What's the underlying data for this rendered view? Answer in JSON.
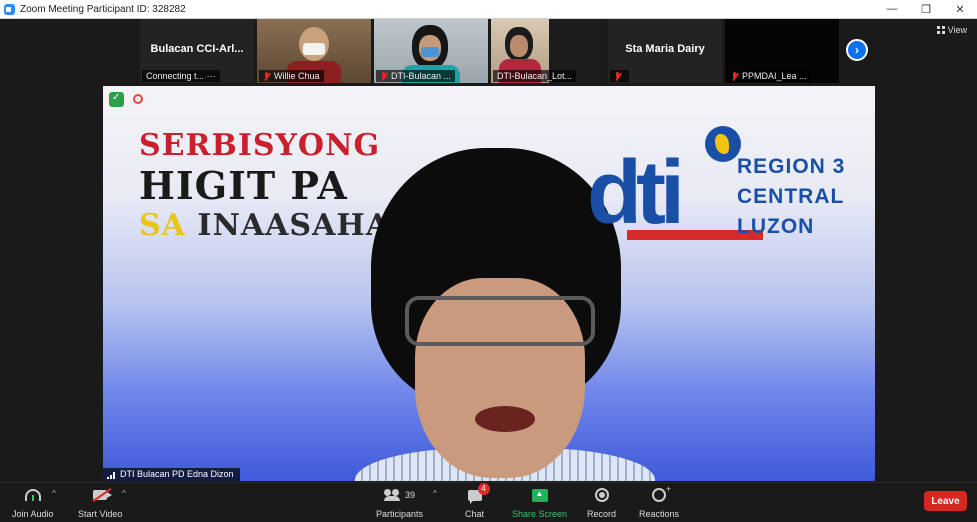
{
  "window": {
    "title": "Zoom Meeting Participant ID: 328282",
    "minimize": "—",
    "restore": "❐",
    "close": "✕"
  },
  "gallery": {
    "tiles": [
      {
        "name": "Bulacan  CCI-Arl...",
        "label": "Connecting t...",
        "extra": "···",
        "video": false
      },
      {
        "name": "",
        "label": "Willie Chua",
        "video": true,
        "muted": true
      },
      {
        "name": "",
        "label": "DTI-Bulacan ...",
        "video": true,
        "muted": true
      },
      {
        "name": "",
        "label": "DTI-Bulacan_Lot...",
        "video": true,
        "muted": false
      },
      {
        "name": "Sta Maria Dairy",
        "label": "",
        "video": false,
        "muted": true
      },
      {
        "name": "",
        "label": "PPMDAI_Lea ...",
        "video": false,
        "muted": true
      }
    ],
    "next_arrow": "›",
    "view_label": "View"
  },
  "speaker": {
    "slogan_line1": "SERBISYONG",
    "slogan_line2": "HIGIT PA",
    "slogan_line3_a": "SA",
    "slogan_line3_b": "INAASAHAN",
    "logo_text": "dti",
    "region_line1": "REGION 3",
    "region_line2": "CENTRAL",
    "region_line3": "LUZON",
    "name_label": "DTI Bulacan PD Edna Dizon"
  },
  "toolbar": {
    "join_audio": "Join Audio",
    "start_video": "Start Video",
    "participants": "Participants",
    "participants_count": "39",
    "chat": "Chat",
    "chat_badge": "4",
    "share_screen": "Share Screen",
    "record": "Record",
    "reactions": "Reactions",
    "leave": "Leave",
    "caret": "^"
  },
  "colors": {
    "accent": "#0e72ed",
    "share": "#23b25a",
    "leave": "#d7281f",
    "dti_blue": "#1a4fa8",
    "dti_red": "#d62b2b"
  }
}
